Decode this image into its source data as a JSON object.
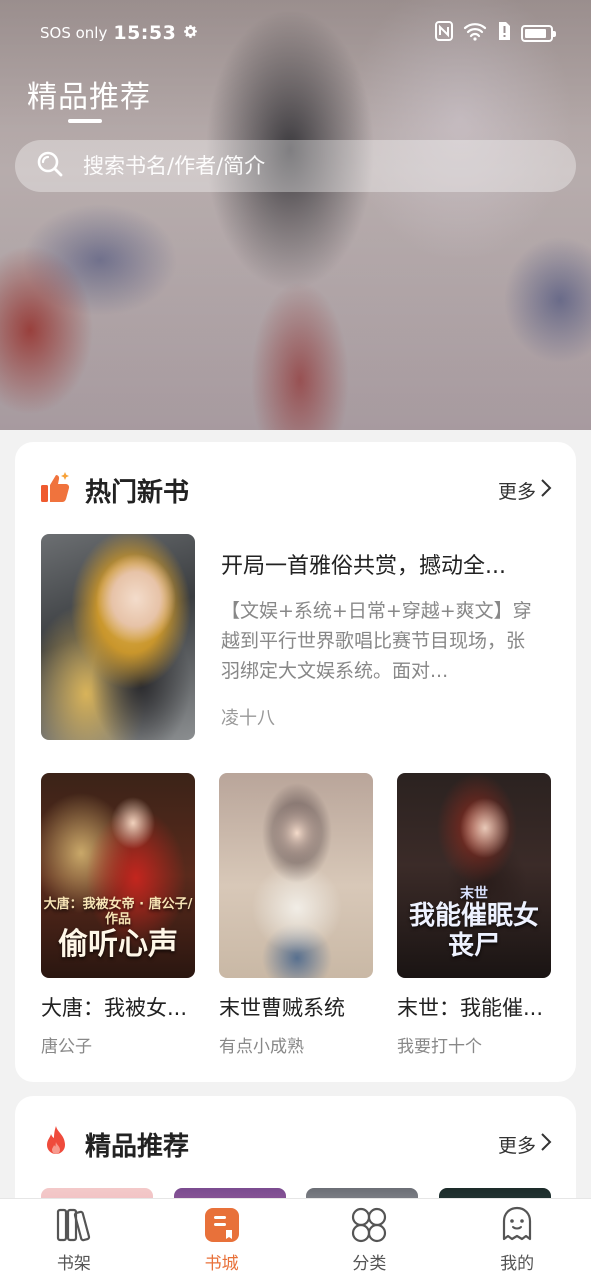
{
  "status_bar": {
    "carrier": "SOS only",
    "time": "15:53"
  },
  "header": {
    "title": "精品推荐"
  },
  "search": {
    "placeholder": "搜索书名/作者/简介"
  },
  "hot_section": {
    "title": "热门新书",
    "more_label": "更多",
    "featured": {
      "title": "开局一首雅俗共赏，撼动全...",
      "description": "【文娱+系统+日常+穿越+爽文】穿越到平行世界歌唱比赛节目现场，张羽绑定大文娱系统。面对...",
      "author": "凌十八"
    },
    "books": [
      {
        "title": "大唐：我被女...",
        "author": "唐公子",
        "cover_text_big": "偷听心声",
        "cover_text_small": "大唐：我被女帝 · 唐公子/作品"
      },
      {
        "title": "末世曹贼系统",
        "author": "有点小成熟"
      },
      {
        "title": "末世：我能催...",
        "author": "我要打十个",
        "cover_text_big": "我能催眠女丧尸",
        "cover_text_small": "末世"
      }
    ]
  },
  "rec_section": {
    "title": "精品推荐",
    "more_label": "更多"
  },
  "tabs": [
    {
      "label": "书架",
      "icon": "bookshelf-icon"
    },
    {
      "label": "书城",
      "icon": "bookstore-icon",
      "active": true
    },
    {
      "label": "分类",
      "icon": "category-icon"
    },
    {
      "label": "我的",
      "icon": "profile-icon"
    }
  ],
  "colors": {
    "accent": "#e8713a",
    "card_bg": "#ffffff",
    "page_bg": "#f2f2f2"
  }
}
